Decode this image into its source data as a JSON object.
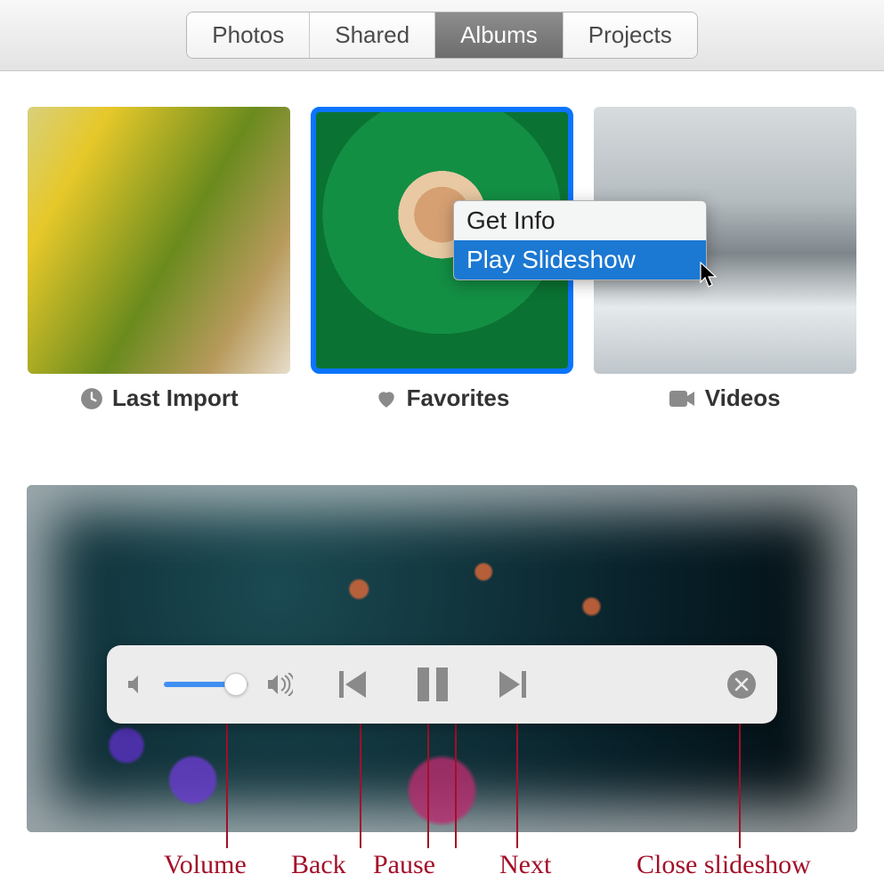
{
  "tabs": {
    "photos": "Photos",
    "shared": "Shared",
    "albums": "Albums",
    "projects": "Projects"
  },
  "albums": {
    "last_import": "Last Import",
    "favorites": "Favorites",
    "videos": "Videos"
  },
  "context_menu": {
    "get_info": "Get Info",
    "play_slideshow": "Play Slideshow"
  },
  "callouts": {
    "volume": "Volume",
    "back": "Back",
    "pause": "Pause",
    "next": "Next",
    "close": "Close slideshow"
  }
}
